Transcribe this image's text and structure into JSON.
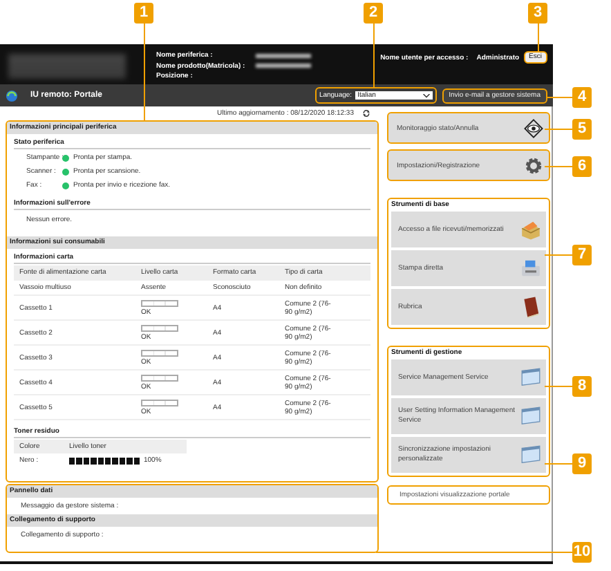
{
  "header": {
    "device_labels": [
      "Nome periferica :",
      "Nome prodotto(Matricola) :",
      "Posizione :"
    ],
    "login_label": "Nome utente per accesso :",
    "user": "Administrato",
    "logout_button": "Esci"
  },
  "toolbar": {
    "title": "IU remoto: Portale",
    "language_label": "Language:",
    "language": "Italian",
    "mail_button": "Invio e-mail a gestore sistema"
  },
  "last_update": "Ultimo aggiornamento : 08/12/2020 18:12:33",
  "device_info": {
    "title": "Informazioni principali periferica",
    "status_title": "Stato periferica",
    "status": [
      {
        "label": "Stampante :",
        "text": "Pronta per stampa.",
        "color": "#27c26a"
      },
      {
        "label": "Scanner :",
        "text": "Pronta per scansione.",
        "color": "#27c26a"
      },
      {
        "label": "Fax :",
        "text": "Pronta per invio e ricezione fax.",
        "color": "#27c26a"
      }
    ],
    "error_title": "Informazioni sull'errore",
    "error_text": "Nessun errore."
  },
  "consumables": {
    "title": "Informazioni sui consumabili",
    "paper_title": "Informazioni carta",
    "paper_columns": [
      "Fonte di alimentazione carta",
      "Livello carta",
      "Formato carta",
      "Tipo di carta"
    ],
    "paper_rows": [
      {
        "source": "Vassoio multiuso",
        "level_text": "Assente",
        "size": "Sconosciuto",
        "type": "Non definito"
      },
      {
        "source": "Cassetto 1",
        "level": 0,
        "level_text": "OK",
        "size": "A4",
        "type": "Comune 2 (76-90 g/m2)"
      },
      {
        "source": "Cassetto 2",
        "level": 0,
        "level_text": "OK",
        "size": "A4",
        "type": "Comune 2 (76-90 g/m2)"
      },
      {
        "source": "Cassetto 3",
        "level": 0,
        "level_text": "OK",
        "size": "A4",
        "type": "Comune 2 (76-90 g/m2)"
      },
      {
        "source": "Cassetto 4",
        "level": 0,
        "level_text": "OK",
        "size": "A4",
        "type": "Comune 2 (76-90 g/m2)"
      },
      {
        "source": "Cassetto 5",
        "level": 0,
        "level_text": "OK",
        "size": "A4",
        "type": "Comune 2 (76-90 g/m2)"
      }
    ],
    "toner_title": "Toner residuo",
    "toner_columns": [
      "Colore",
      "Livello toner"
    ],
    "toner_rows": [
      {
        "color_name": "Nero :",
        "level": 1,
        "reading": "100%"
      }
    ]
  },
  "data_panel": {
    "title": "Pannello dati",
    "text": "Messaggio da gestore sistema :"
  },
  "support": {
    "title": "Collegamento di supporto",
    "text": "Collegamento di supporto :"
  },
  "main_buttons": [
    {
      "label": "Monitoraggio stato/Annulla",
      "kind": "eye"
    },
    {
      "label": "Impostazioni/Registrazione",
      "kind": "gear"
    }
  ],
  "tool_groups": [
    {
      "title": "Strumenti di base",
      "items": [
        {
          "label": "Accesso a file ricevuti/memorizzati",
          "kind": "inbox"
        },
        {
          "label": "Stampa diretta",
          "kind": "printer"
        },
        {
          "label": "Rubrica",
          "kind": "book"
        }
      ]
    },
    {
      "title": "Strumenti di gestione",
      "items": [
        {
          "label": "Service Management Service",
          "kind": "window"
        },
        {
          "label": "User Setting Information Management Service",
          "kind": "window"
        },
        {
          "label": "Sincronizzazione impostazioni personalizzate",
          "kind": "window"
        }
      ]
    }
  ],
  "portal_link": "Impostazioni visualizzazione portale",
  "callouts": [
    "1",
    "2",
    "3",
    "4",
    "5",
    "6",
    "7",
    "8",
    "9",
    "10"
  ]
}
